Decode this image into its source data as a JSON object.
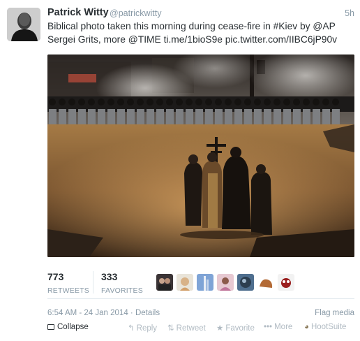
{
  "tweet": {
    "fullname": "Patrick Witty",
    "username": "@patrickwitty",
    "time_ago": "5h",
    "text_line1": "Biblical photo taken this morning during cease-fire in #Kiev by @AP",
    "text_line2": "Sergei Grits, more @TIME ti.me/1bioS9e pic.twitter.com/IIBC6jP90v"
  },
  "stats": {
    "retweets_count": "773",
    "retweets_label": "RETWEETS",
    "favorites_count": "333",
    "favorites_label": "FAVORITES"
  },
  "meta": {
    "timestamp": "6:54 AM - 24 Jan 2014",
    "separator": " · ",
    "details_link": "Details",
    "flag_media": "Flag media"
  },
  "actions": {
    "collapse": "Collapse",
    "reply": "Reply",
    "retweet": "Retweet",
    "favorite": "Favorite",
    "more": "More",
    "hootsuite": "HootSuite"
  },
  "icons": {
    "collapse": "collapse-icon",
    "reply": "reply-icon",
    "retweet": "retweet-icon",
    "favorite": "star-icon",
    "more": "more-dots-icon",
    "hootsuite": "hootsuite-owl-icon"
  },
  "colors": {
    "text": "#292f33",
    "muted": "#8899a6",
    "action_muted": "#b1bbc3",
    "border": "#e1e8ed"
  }
}
